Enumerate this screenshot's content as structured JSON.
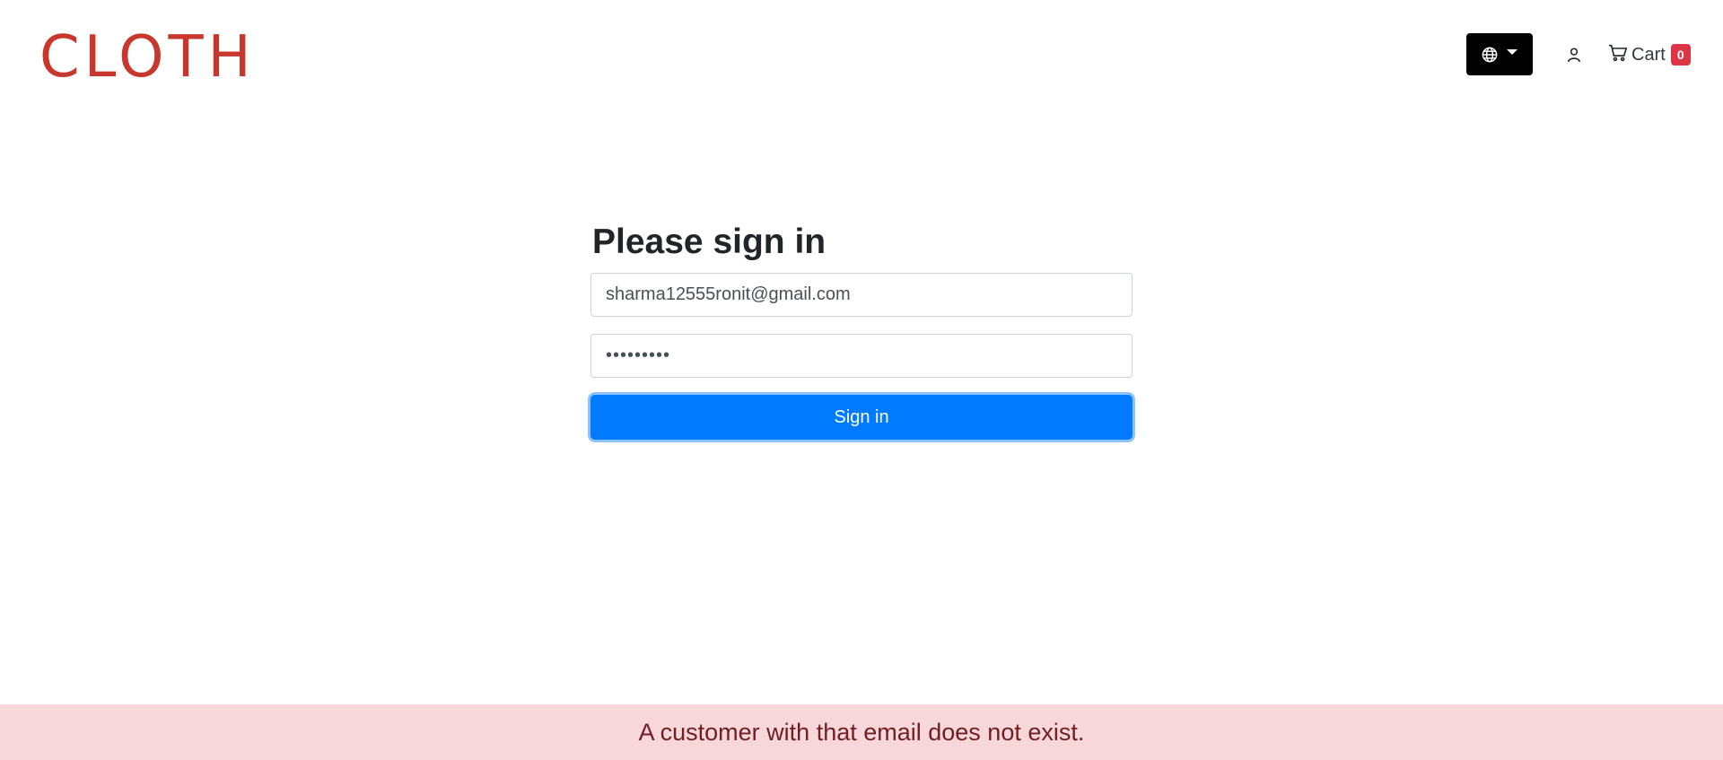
{
  "header": {
    "logo_text": "CLOTH",
    "language_button": {
      "icon": "globe-icon"
    },
    "user_link": {
      "icon": "user-icon"
    },
    "cart": {
      "icon": "cart-icon",
      "label": "Cart",
      "count": "0"
    }
  },
  "signin": {
    "title": "Please sign in",
    "email_value": "sharma12555ronit@gmail.com",
    "password_value": "•••••••••",
    "submit_label": "Sign in"
  },
  "alert": {
    "message": "A customer with that email does not exist."
  },
  "colors": {
    "logo": "#c8372d",
    "primary": "#007bff",
    "badge": "#dc3545",
    "alert_bg": "#f8d7da",
    "alert_text": "#721c24"
  }
}
